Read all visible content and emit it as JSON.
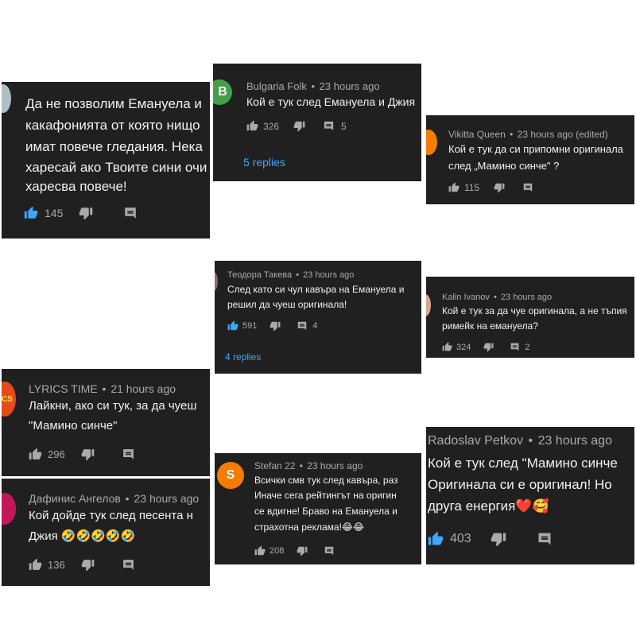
{
  "colors": {
    "card_bg": "#202020",
    "text": "#f1f1f1",
    "meta": "#aaaaaa",
    "link": "#3ea6ff",
    "like_active": "#3ea6ff"
  },
  "comments": [
    {
      "id": "c1",
      "author": "",
      "time": "",
      "text_lines": [
        "Да не позволим Емануела и",
        "какафонията от която нищо",
        "имат повече гледания. Нека",
        "харесай ако Твоите сини очи",
        "харесва повече!"
      ],
      "likes": "145",
      "replies_count": "",
      "replies_link": "",
      "avatar": {
        "letter": "",
        "color": "#b0bec5"
      }
    },
    {
      "id": "c2",
      "author": "Bulgaria Folk",
      "time": "23 hours ago",
      "text_lines": [
        "Кой е тук след Емануела и Джия"
      ],
      "likes": "326",
      "replies_count": "5",
      "replies_link": "5 replies",
      "avatar": {
        "letter": "B",
        "color": "#43a047"
      }
    },
    {
      "id": "c3",
      "author": "Vikitta Queen",
      "time": "23 hours ago (edited)",
      "text_lines": [
        "Кой е тук да си припомни оригинала",
        "след „Мамино синче\" ?"
      ],
      "likes": "115",
      "replies_count": "",
      "replies_link": "",
      "avatar": {
        "letter": "",
        "color": "#f57c00"
      }
    },
    {
      "id": "c4",
      "author": "Теодора Такева",
      "time": "23 hours ago",
      "text_lines": [
        "След като си чул кавъра на Емануела и",
        "решил да чуеш оригинала!"
      ],
      "likes": "591",
      "replies_count": "4",
      "replies_link": "4 replies",
      "avatar": {
        "letter": "",
        "color": "#8d6e63"
      }
    },
    {
      "id": "c5",
      "author": "Kalin Ivanov",
      "time": "23 hours ago",
      "text_lines": [
        "Кой е тук за да чуе оригинала, а не тъпия",
        "римейк на емануела?"
      ],
      "likes": "324",
      "replies_count": "2",
      "replies_link": "",
      "avatar": {
        "letter": "",
        "color": "#d7a98c"
      }
    },
    {
      "id": "c6",
      "author": "LYRICS TIME",
      "time": "21 hours ago",
      "text_lines": [
        "Лайкни, ако си тук, за да чуеш",
        "\"Мамино синче\""
      ],
      "likes": "296",
      "replies_count": "",
      "replies_link": "",
      "avatar": {
        "letter": "CS",
        "color": "#e64a19"
      }
    },
    {
      "id": "c7",
      "author": "Stefan 22",
      "time": "23 hours ago",
      "text_lines": [
        "Всички смв тук след кавъра, раз",
        "Иначе сега рейтингът на оригин",
        "се вдигне! Браво на Емануела и",
        "страхотна реклама!😂😂"
      ],
      "likes": "208",
      "replies_count": "",
      "replies_link": "",
      "avatar": {
        "letter": "S",
        "color": "#f57c00"
      }
    },
    {
      "id": "c8",
      "author": "Radoslav Petkov",
      "time": "23 hours ago",
      "text_lines": [
        "Кой е тук след \"Мамино синче",
        "Оригинала си е оригинал! Но",
        "друга енергия❤️🥰"
      ],
      "likes": "403",
      "replies_count": "",
      "replies_link": "",
      "avatar": {
        "letter": "",
        "color": ""
      }
    },
    {
      "id": "c9",
      "author": "Дафинис Ангелов",
      "time": "23 hours ago",
      "text_lines": [
        "Кой дойде тук след песента н",
        "Джия 🤣🤣🤣🤣🤣"
      ],
      "likes": "136",
      "replies_count": "",
      "replies_link": "",
      "avatar": {
        "letter": "",
        "color": "#c2185b"
      }
    }
  ]
}
